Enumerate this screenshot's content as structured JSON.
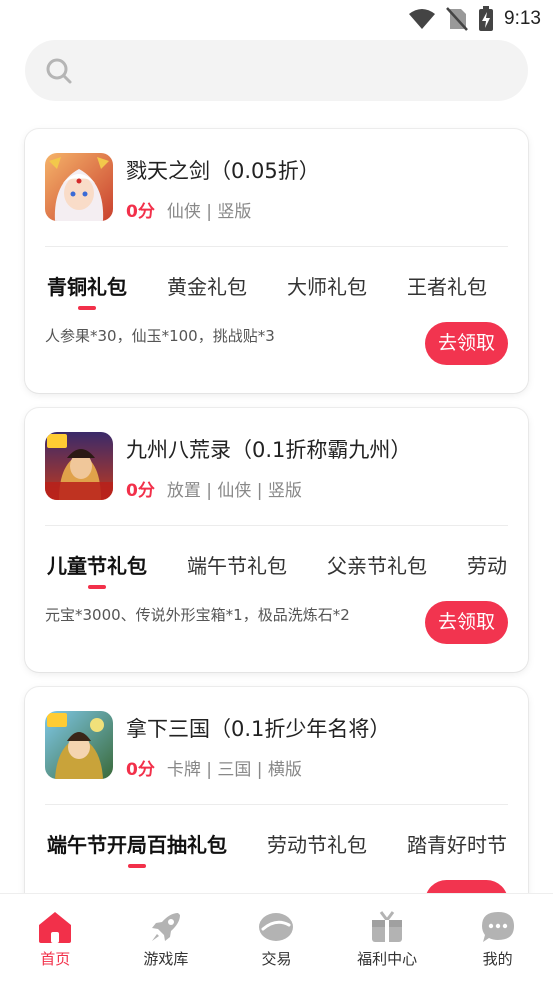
{
  "status_bar": {
    "time": "9:13"
  },
  "search": {
    "placeholder": ""
  },
  "games": [
    {
      "title": "戮天之剑（0.05折）",
      "price": "0分",
      "tags": "仙侠 | 竖版",
      "tabs": [
        "青铜礼包",
        "黄金礼包",
        "大师礼包",
        "王者礼包"
      ],
      "active_tab": 0,
      "reward": "人参果*30，仙玉*100，挑战贴*3",
      "claim_label": "去领取"
    },
    {
      "title": "九州八荒录（0.1折称霸九州）",
      "price": "0分",
      "tags": "放置 | 仙侠 | 竖版",
      "tabs": [
        "儿童节礼包",
        "端午节礼包",
        "父亲节礼包",
        "劳动"
      ],
      "active_tab": 0,
      "reward": "元宝*3000、传说外形宝箱*1，极品洗炼石*2",
      "claim_label": "去领取"
    },
    {
      "title": "拿下三国（0.1折少年名将）",
      "price": "0分",
      "tags": "卡牌 | 三国 | 横版",
      "tabs": [
        "端午节开局百抽礼包",
        "劳动节礼包",
        "踏青好时节"
      ],
      "active_tab": 0,
      "reward": "",
      "claim_label": ""
    }
  ],
  "nav": [
    {
      "label": "首页",
      "icon": "home-icon"
    },
    {
      "label": "游戏库",
      "icon": "rocket-icon"
    },
    {
      "label": "交易",
      "icon": "trade-icon"
    },
    {
      "label": "福利中心",
      "icon": "gift-icon"
    },
    {
      "label": "我的",
      "icon": "chat-bubble-icon"
    }
  ],
  "colors": {
    "accent": "#f2304a",
    "nav_icon": "#b3b3b3"
  }
}
